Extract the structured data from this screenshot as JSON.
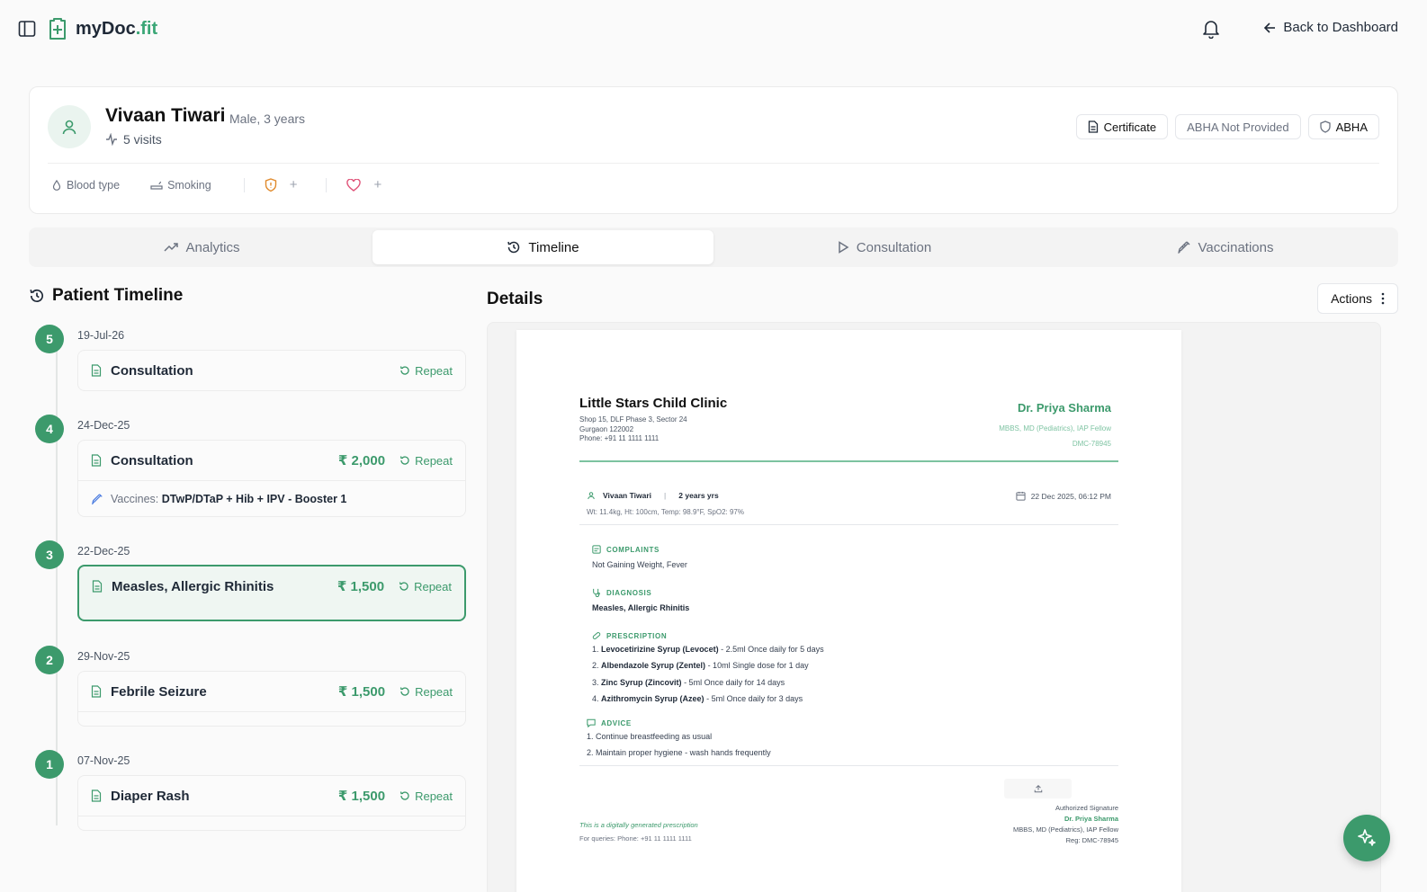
{
  "header": {
    "brand_main": "myDoc",
    "brand_tld": ".fit",
    "back_label": "Back to Dashboard",
    "icons": [
      "sidebar-toggle-icon",
      "medical-plus-icon",
      "bell-icon",
      "arrow-left-icon"
    ]
  },
  "patient": {
    "name": "Vivaan Tiwari",
    "meta": "Male, 3 years",
    "visits": "5 visits",
    "badges": {
      "certificate": "Certificate",
      "abha_status": "ABHA Not Provided",
      "abha": "ABHA"
    },
    "traits": {
      "blood_type": "Blood type",
      "smoking": "Smoking",
      "add_1": "+",
      "add_2": "+"
    }
  },
  "tabs": [
    {
      "label": "Analytics",
      "active": false
    },
    {
      "label": "Timeline",
      "active": true
    },
    {
      "label": "Consultation",
      "active": false
    },
    {
      "label": "Vaccinations",
      "active": false
    }
  ],
  "timeline": {
    "title": "Patient Timeline",
    "repeat_label": "Repeat",
    "items": [
      {
        "num": "5",
        "date": "19-Jul-26",
        "label": "Consultation",
        "price": ""
      },
      {
        "num": "4",
        "date": "24-Dec-25",
        "label": "Consultation",
        "price": "₹ 2,000",
        "vaccines_label": "Vaccines:",
        "vaccines": "DTwP/DTaP + Hib + IPV - Booster 1"
      },
      {
        "num": "3",
        "date": "22-Dec-25",
        "label": "Measles, Allergic Rhinitis",
        "price": "₹ 1,500",
        "selected": true
      },
      {
        "num": "2",
        "date": "29-Nov-25",
        "label": "Febrile Seizure",
        "price": "₹ 1,500"
      },
      {
        "num": "1",
        "date": "07-Nov-25",
        "label": "Diaper Rash",
        "price": "₹ 1,500"
      }
    ]
  },
  "details": {
    "title": "Details",
    "actions_label": "Actions",
    "prescription": {
      "clinic_name": "Little Stars Child Clinic",
      "clinic_addr1": "Shop 15, DLF Phase 3, Sector 24",
      "clinic_addr2": "Gurgaon 122002",
      "clinic_phone": "Phone: +91 11 1111 1111",
      "doctor_name": "Dr. Priya Sharma",
      "doctor_quals": "MBBS, MD (Pediatrics), IAP Fellow",
      "doctor_reg": "DMC-78945",
      "patient_name": "Vivaan Tiwari",
      "patient_sep": "|",
      "patient_age": "2 years yrs",
      "visit_datetime": "22 Dec 2025, 06:12 PM",
      "vitals": "Wt: 11.4kg, Ht: 100cm, Temp: 98.9°F, SpO2: 97%",
      "complaints_h": "COMPLAINTS",
      "complaints": "Not Gaining Weight, Fever",
      "diagnosis_h": "DIAGNOSIS",
      "diagnosis": "Measles, Allergic Rhinitis",
      "prescription_h": "PRESCRIPTION",
      "meds": [
        {
          "n": "1.",
          "name": "Levocetirizine Syrup (Levocet)",
          "dose": "- 2.5ml Once daily for 5 days"
        },
        {
          "n": "2.",
          "name": "Albendazole Syrup (Zentel)",
          "dose": "- 10ml Single dose for 1 day"
        },
        {
          "n": "3.",
          "name": "Zinc Syrup (Zincovit)",
          "dose": "- 5ml Once daily for 14 days"
        },
        {
          "n": "4.",
          "name": "Azithromycin Syrup (Azee)",
          "dose": "- 5ml Once daily for 3 days"
        }
      ],
      "advice_h": "ADVICE",
      "advice": [
        "1. Continue breastfeeding as usual",
        "2. Maintain proper hygiene - wash hands frequently"
      ],
      "sign_label": "Authorized Signature",
      "sign_name": "Dr. Priya Sharma",
      "sign_quals": "MBBS, MD (Pediatrics), IAP Fellow",
      "sign_reg": "Reg: DMC-78945",
      "footer_note": "This is a digitally generated prescription",
      "footer_queries": "For queries: Phone: +91 11 1111 1111"
    }
  },
  "colors": {
    "accent": "#3c9a6c",
    "accent_light": "#eff6f2",
    "background": "#fafafa"
  }
}
